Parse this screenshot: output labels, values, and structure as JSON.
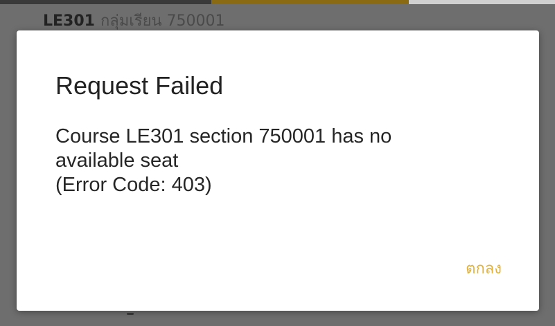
{
  "background": {
    "course_code": "LE301",
    "section_text": "กลุ่มเรียน 750001"
  },
  "dialog": {
    "title": "Request Failed",
    "message_lines": [
      "Course LE301 section 750001 has no",
      "available seat",
      "(Error Code: 403)"
    ],
    "ok_label": "ตกลง"
  },
  "colors": {
    "scrim": "#6e6e6e",
    "dialog_bg": "#ffffff",
    "accent": "#e3b23c",
    "title_text": "#222222"
  }
}
